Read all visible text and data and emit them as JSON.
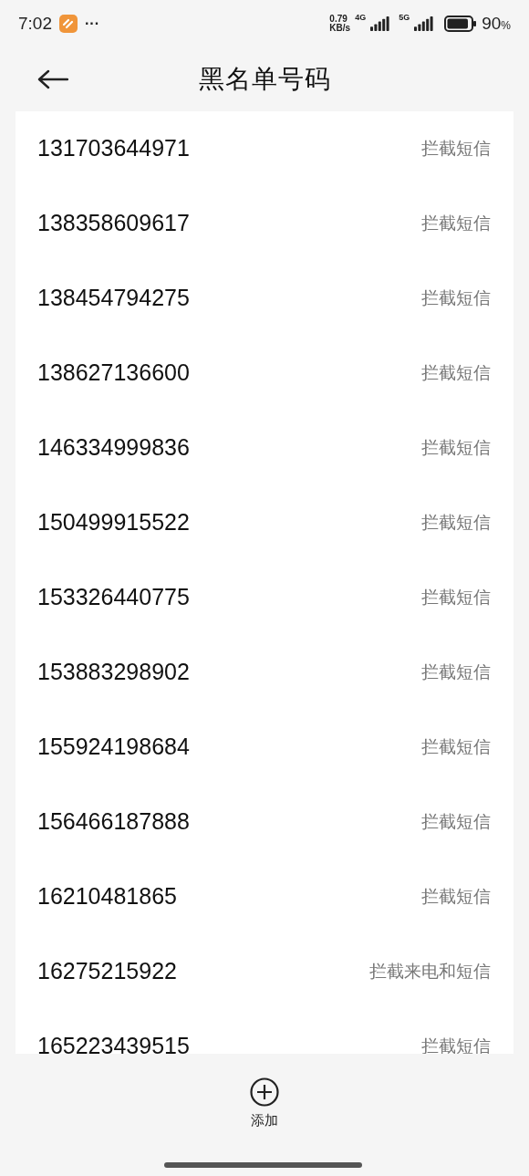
{
  "status_bar": {
    "time": "7:02",
    "more": "···",
    "speed_value": "0.79",
    "speed_unit": "KB/s",
    "network_1": "4G",
    "network_2": "5G",
    "battery": "90",
    "battery_unit": "%"
  },
  "header": {
    "title": "黑名单号码"
  },
  "blacklist": [
    {
      "number": "131703644971",
      "mode": "拦截短信"
    },
    {
      "number": "138358609617",
      "mode": "拦截短信"
    },
    {
      "number": "138454794275",
      "mode": "拦截短信"
    },
    {
      "number": "138627136600",
      "mode": "拦截短信"
    },
    {
      "number": "146334999836",
      "mode": "拦截短信"
    },
    {
      "number": "150499915522",
      "mode": "拦截短信"
    },
    {
      "number": "153326440775",
      "mode": "拦截短信"
    },
    {
      "number": "153883298902",
      "mode": "拦截短信"
    },
    {
      "number": "155924198684",
      "mode": "拦截短信"
    },
    {
      "number": "156466187888",
      "mode": "拦截短信"
    },
    {
      "number": "16210481865",
      "mode": "拦截短信"
    },
    {
      "number": "16275215922",
      "mode": "拦截来电和短信"
    },
    {
      "number": "165223439515",
      "mode": "拦截短信"
    }
  ],
  "add_button": {
    "label": "添加"
  }
}
